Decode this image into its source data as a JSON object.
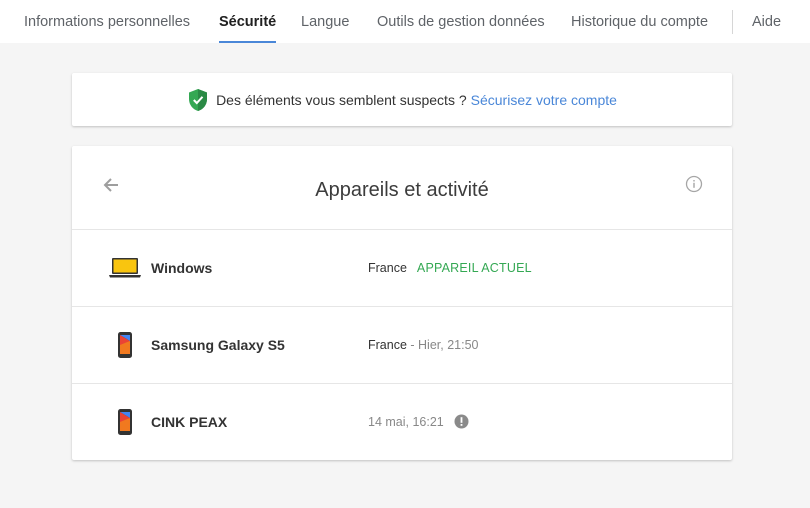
{
  "nav": {
    "tabs": [
      {
        "label": "Informations personnelles"
      },
      {
        "label": "Sécurité"
      },
      {
        "label": "Langue"
      },
      {
        "label": "Outils de gestion données"
      },
      {
        "label": "Historique du compte"
      }
    ],
    "help": "Aide"
  },
  "banner": {
    "text": "Des éléments vous semblent suspects ?",
    "link": "Sécurisez votre compte"
  },
  "devices": {
    "title": "Appareils et activité",
    "rows": [
      {
        "name": "Windows",
        "location": "France",
        "separator": "",
        "time": "",
        "status": "APPAREIL ACTUEL"
      },
      {
        "name": "Samsung Galaxy S5",
        "location": "France",
        "separator": " - ",
        "time": "Hier, 21:50",
        "status": ""
      },
      {
        "name": "CINK PEAX",
        "location": "",
        "separator": "",
        "time": "14 mai, 16:21",
        "status": ""
      }
    ]
  },
  "colors": {
    "accent": "#4a87d8",
    "current_device": "#34a853",
    "shield": "#34a853",
    "laptop_screen": "#f9c50f"
  },
  "icons": [
    "shield-check-icon",
    "arrow-back-icon",
    "info-icon",
    "laptop-icon",
    "phone-icon",
    "alert-icon"
  ]
}
